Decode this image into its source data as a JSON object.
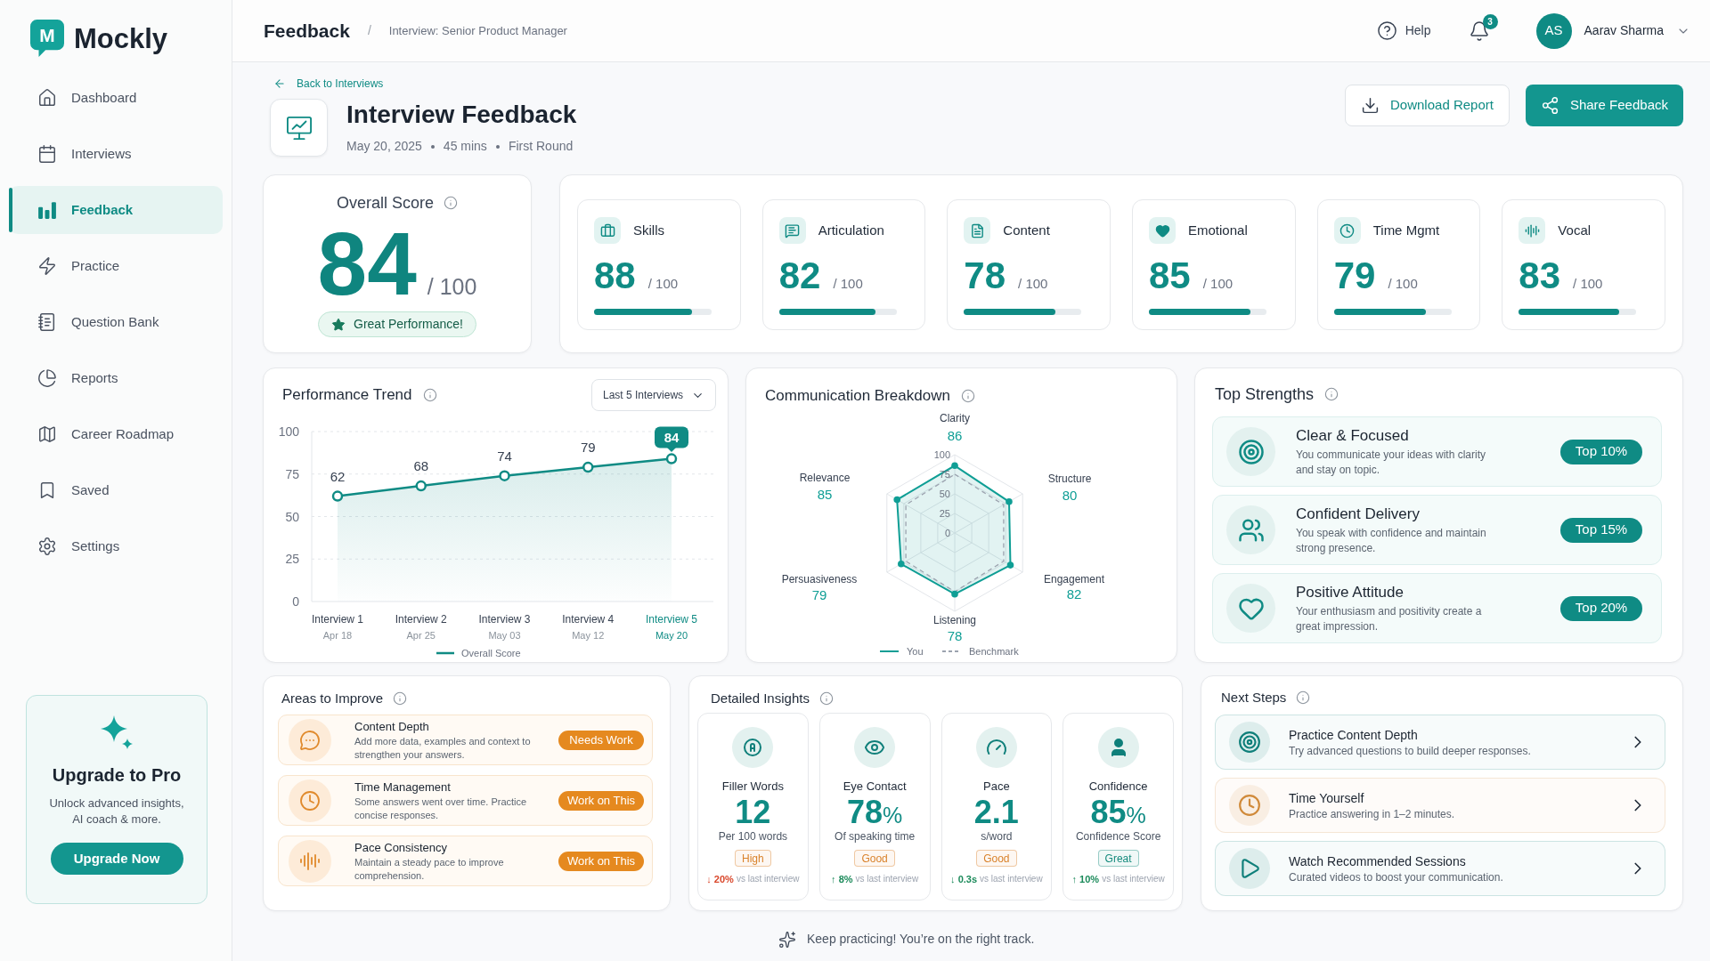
{
  "sidebar": {
    "logo": {
      "mark": "M",
      "name": "Mockly"
    },
    "items": [
      {
        "label": "Dashboard",
        "selected": false
      },
      {
        "label": "Interviews",
        "selected": false
      },
      {
        "label": "Feedback",
        "selected": true
      },
      {
        "label": "Practice",
        "selected": false
      },
      {
        "label": "Question Bank",
        "selected": false
      },
      {
        "label": "Reports",
        "selected": false
      },
      {
        "label": "Career Roadmap",
        "selected": false
      },
      {
        "label": "Saved",
        "selected": false
      },
      {
        "label": "Settings",
        "selected": false
      }
    ],
    "upgrade_card": {
      "title": "Upgrade to Pro",
      "text": "Unlock advanced insights, AI coach & more.",
      "button": "Upgrade Now"
    }
  },
  "header": {
    "title": "Feedback",
    "separator": "/",
    "breadcrumb": "Interview: Senior Product Manager",
    "help": "Help",
    "notification_count": "3",
    "user": {
      "initials": "AS",
      "name": "Aarav Sharma"
    }
  },
  "page_header": {
    "back_link": "Back to Interviews",
    "title": "Interview Feedback",
    "meta": [
      "May 20, 2025",
      "45 mins",
      "First Round"
    ],
    "buttons": [
      {
        "label": "Download Report",
        "kind": "outline"
      },
      {
        "label": "Share Feedback",
        "kind": "primary"
      }
    ]
  },
  "overall_score": {
    "title": "Overall Score",
    "score": "84",
    "out_of": "/ 100",
    "badge": "Great Performance!"
  },
  "score_categories": [
    {
      "label": "Skills",
      "score": "88",
      "out_of": "/ 100",
      "level": 0.83
    },
    {
      "label": "Articulation",
      "score": "82",
      "out_of": "/ 100",
      "level": 0.82
    },
    {
      "label": "Content",
      "score": "78",
      "out_of": "/ 100",
      "level": 0.78
    },
    {
      "label": "Emotional",
      "score": "85",
      "out_of": "/ 100",
      "level": 0.86
    },
    {
      "label": "Time Mgmt",
      "score": "79",
      "out_of": "/ 100",
      "level": 0.78
    },
    {
      "label": "Vocal",
      "score": "83",
      "out_of": "/ 100",
      "level": 0.85
    }
  ],
  "performance_trend": {
    "title": "Performance Trend",
    "range": "Last 5 Interviews",
    "dates": [
      {
        "label": "Apr 18",
        "selected": false
      },
      {
        "label": "Apr 25",
        "selected": false
      },
      {
        "label": "May 03",
        "selected": false
      },
      {
        "label": "May 12",
        "selected": false
      },
      {
        "label": "May 20",
        "selected": true
      }
    ],
    "chart_data": {
      "type": "line",
      "categories": [
        "Interview 1",
        "Interview 2",
        "Interview 3",
        "Interview 4",
        "Interview 5"
      ],
      "series": [
        {
          "name": "Overall Score",
          "color": "#0f8b84",
          "marker": "circle",
          "values": [
            62,
            68,
            74,
            79,
            84
          ]
        }
      ],
      "ylim": [
        0,
        100
      ],
      "yticks": [
        0,
        25,
        50,
        75,
        100
      ],
      "grid": true,
      "legend": "bottom",
      "data_labels": true
    }
  },
  "communication_breakdown": {
    "title": "Communication Breakdown",
    "scores": [
      "86",
      "80",
      "82",
      "78",
      "79",
      "85"
    ],
    "chart_data": {
      "type": "radar",
      "categories": [
        "Clarity",
        "Structure",
        "Engagement",
        "Listening",
        "Persuasiveness",
        "Relevance"
      ],
      "series": [
        {
          "name": "You",
          "color": "#0f9e95",
          "marker": "circle",
          "values": [
            86,
            80,
            82,
            78,
            79,
            85
          ]
        },
        {
          "name": "Benchmark",
          "color": "#9ca3af",
          "values": [
            75,
            72,
            72,
            75,
            72,
            72
          ]
        }
      ],
      "ylim": [
        0,
        100
      ],
      "yticks": [
        0,
        25,
        50,
        75,
        100
      ],
      "legend": "bottom"
    }
  },
  "top_strengths": {
    "title": "Top Strengths",
    "items": [
      {
        "title": "Clear & Focused",
        "text": "You communicate your ideas with clarity and stay on topic.",
        "badge": "Top 10%"
      },
      {
        "title": "Confident Delivery",
        "text": "You speak with confidence and maintain strong presence.",
        "badge": "Top 15%"
      },
      {
        "title": "Positive Attitude",
        "text": "Your enthusiasm and positivity create a great impression.",
        "badge": "Top 20%"
      }
    ]
  },
  "areas_to_improve": {
    "title": "Areas to Improve",
    "items": [
      {
        "title": "Content Depth",
        "text": "Add more data, examples and context to strengthen your answers.",
        "badge": "Needs Work"
      },
      {
        "title": "Time Management",
        "text": "Some answers went over time. Practice concise responses.",
        "badge": "Work on This"
      },
      {
        "title": "Pace Consistency",
        "text": "Maintain a steady pace to improve comprehension.",
        "badge": "Work on This"
      }
    ]
  },
  "detailed_insights": {
    "title": "Detailed Insights",
    "items": [
      {
        "label": "Filler Words",
        "value": "12",
        "unit": "Per 100 words",
        "badge": {
          "label": "High",
          "color": "#d9822b"
        },
        "change": {
          "value": "↓ 20%",
          "text": "vs last interview",
          "color": "#d9472b"
        }
      },
      {
        "label": "Eye Contact",
        "value": "78",
        "suffix": "%",
        "unit": "Of speaking time",
        "badge": {
          "label": "Good",
          "color": "#d9822b"
        },
        "change": {
          "value": "↑ 8%",
          "text": "vs last interview",
          "color": "#1b8a5a"
        }
      },
      {
        "label": "Pace",
        "value": "2.1",
        "unit": "s/word",
        "badge": {
          "label": "Good",
          "color": "#d9822b"
        },
        "change": {
          "value": "↓ 0.3s",
          "text": "vs last interview",
          "color": "#1b8a5a"
        }
      },
      {
        "label": "Confidence",
        "value": "85",
        "suffix": "%",
        "unit": "Confidence Score",
        "badge": {
          "label": "Great",
          "color": "#138a7c"
        },
        "change": {
          "value": "↑ 10%",
          "text": "vs last interview",
          "color": "#1b8a5a"
        }
      }
    ]
  },
  "next_steps": {
    "title": "Next Steps",
    "items": [
      {
        "title": "Practice Content Depth",
        "text": "Try advanced questions to build deeper responses.",
        "color": "#0f7f7a"
      },
      {
        "title": "Time Yourself",
        "text": "Practice answering in 1–2 minutes.",
        "color": "#d08a3a"
      },
      {
        "title": "Watch Recommended Sessions",
        "text": "Curated videos to boost your communication.",
        "color": "#0f7f7a"
      }
    ]
  },
  "footer_note": "Keep practicing! You’re on the right track."
}
